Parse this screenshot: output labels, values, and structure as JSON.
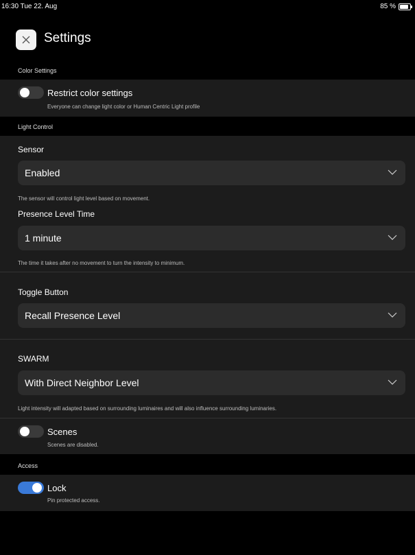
{
  "status_bar": {
    "time": "16:30  Tue 22. Aug",
    "battery": "85 %"
  },
  "header": {
    "title": "Settings",
    "close_icon": "close-icon"
  },
  "color_settings": {
    "section_label": "Color Settings",
    "restrict": {
      "label": "Restrict color settings",
      "description": "Everyone can change light color or Human Centric Light profile",
      "enabled": false
    }
  },
  "light_control": {
    "section_label": "Light Control",
    "sensor": {
      "label": "Sensor",
      "value": "Enabled",
      "hint": "The sensor will control light level based on movement."
    },
    "presence_level_time": {
      "label": "Presence Level Time",
      "value": "1 minute",
      "hint": "The time it takes after no movement to turn the intensity to minimum."
    },
    "toggle_button": {
      "label": "Toggle Button",
      "value": "Recall Presence Level"
    },
    "swarm": {
      "label": "SWARM",
      "value": "With Direct Neighbor Level",
      "hint": "Light intensity will adapted based on surrounding luminaires and will also influence surrounding luminaries."
    },
    "scenes": {
      "label": "Scenes",
      "description": "Scenes are disabled.",
      "enabled": false
    }
  },
  "access": {
    "section_label": "Access",
    "lock": {
      "label": "Lock",
      "description": "Pin protected access.",
      "enabled": true
    }
  },
  "colors": {
    "background": "#000000",
    "panel": "#1c1c1c",
    "field": "#2c2c2c",
    "accent": "#3a7ad8"
  }
}
